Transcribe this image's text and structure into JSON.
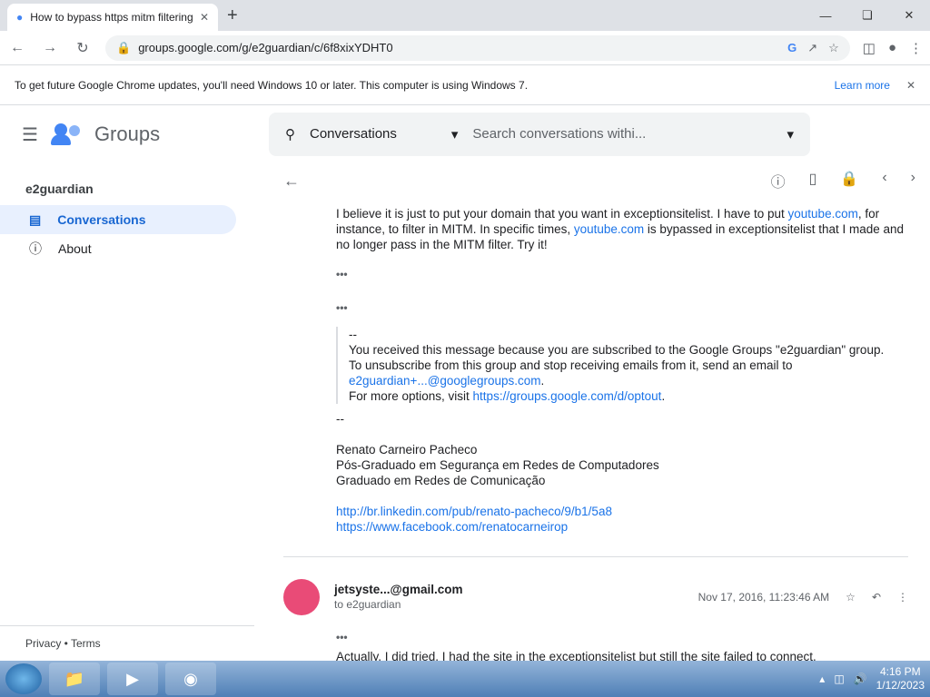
{
  "browser": {
    "tab_title": "How to bypass https mitm filtering",
    "url": "groups.google.com/g/e2guardian/c/6f8xixYDHT0",
    "info_message": "To get future Google Chrome updates, you'll need Windows 10 or later. This computer is using Windows 7.",
    "learn_more": "Learn more"
  },
  "app": {
    "brand": "Groups",
    "group_name": "e2guardian",
    "nav": [
      {
        "label": "Conversations"
      },
      {
        "label": "About"
      }
    ],
    "footer": "Privacy • Terms",
    "search_scope": "Conversations",
    "search_placeholder": "Search conversations withi..."
  },
  "message1": {
    "body_start": "I believe it is just to put your domain that you want in exceptionsitelist. I have to put ",
    "link1": "youtube.com",
    "body_mid": ", for instance, to filter in MITM. In specific times, ",
    "link2": "youtube.com",
    "body_end": " is bypassed in exceptionsitelist that I made and no longer pass in the MITM filter. Try it!",
    "quote_dash": "--",
    "quote_line1": "You received this message because you are subscribed to the Google Groups \"e2guardian\" group.",
    "quote_line2": "To unsubscribe from this group and stop receiving emails from it, send an email to",
    "quote_email": "e2guardian+...@googlegroups.com",
    "quote_line3_prefix": "For more options, visit ",
    "quote_link": "https://groups.google.com/d/optout",
    "sig_dash": "--",
    "sig_name": "Renato Carneiro Pacheco",
    "sig_line1": "Pós-Graduado em Segurança em Redes de Computadores",
    "sig_line2": "Graduado em Redes de Comunicação",
    "sig_link1": "http://br.linkedin.com/pub/renato-pacheco/9/b1/5a8",
    "sig_link2": "https://www.facebook.com/renatocarneirop"
  },
  "message2": {
    "author": "jetsyste...@gmail.com",
    "recipient": "to e2guardian",
    "date": "Nov 17, 2016, 11:23:46 AM",
    "body": "Actually, I did tried. I had the site in the exceptionsitelist but still the site failed to connect."
  },
  "taskbar": {
    "time": "4:16 PM",
    "date": "1/12/2023"
  }
}
